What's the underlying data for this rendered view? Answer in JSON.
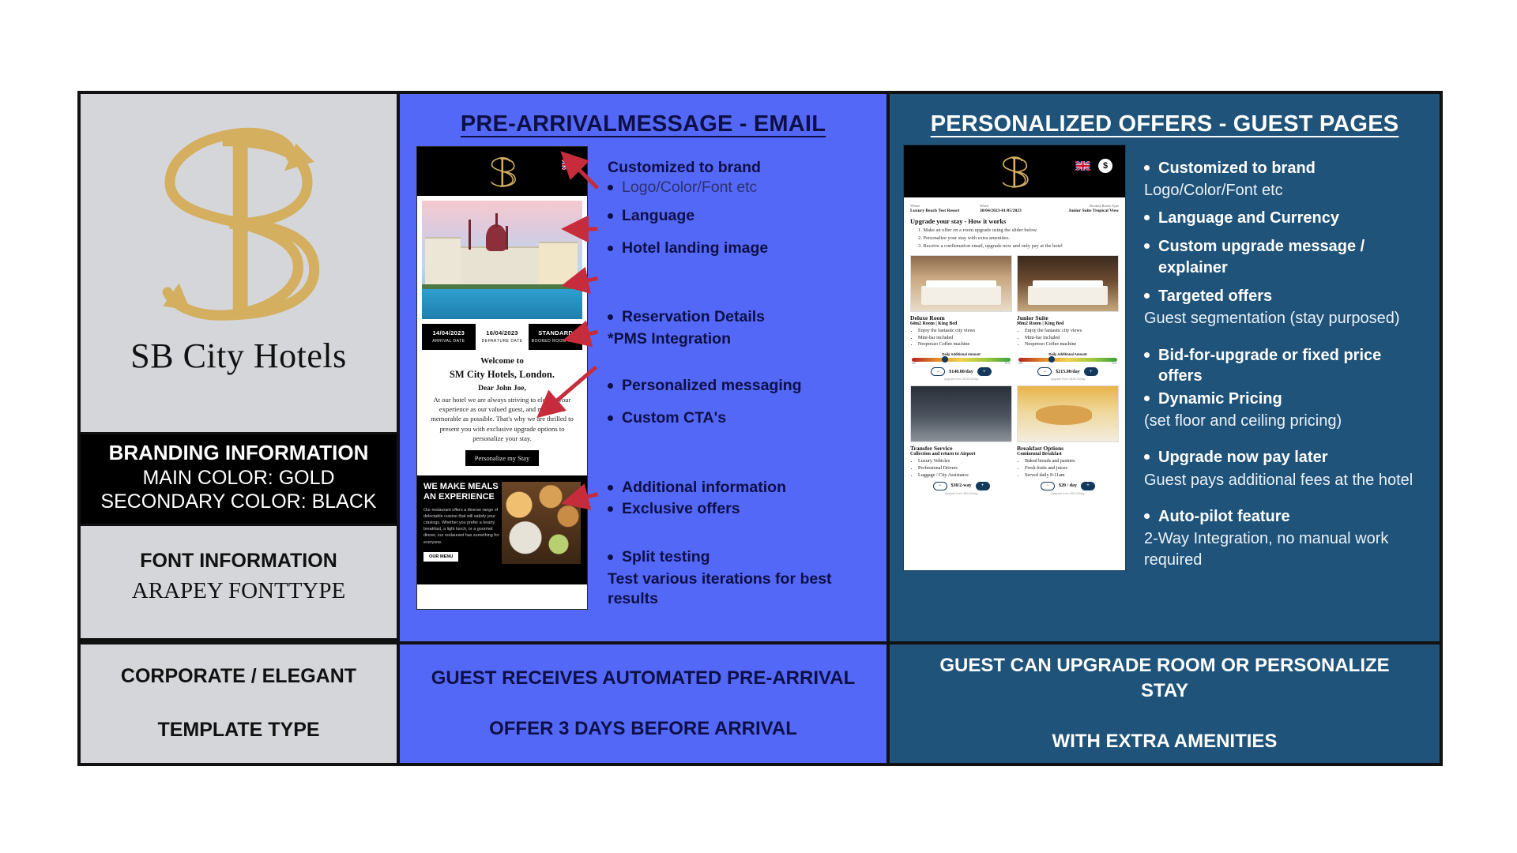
{
  "brand": {
    "logo_icon": "sb-monogram-logo",
    "name": "SB City Hotels",
    "branding_title": "BRANDING INFORMATION",
    "main_color_line": "MAIN COLOR: GOLD",
    "secondary_color_line": "SECONDARY COLOR: BLACK",
    "font_title": "FONT INFORMATION",
    "font_value": "ARAPEY FONTTYPE",
    "template_type": "CORPORATE / ELEGANT\nTEMPLATE TYPE",
    "template_type_line1": "CORPORATE / ELEGANT",
    "template_type_line2": "TEMPLATE TYPE",
    "colors": {
      "gold": "#d4af5f",
      "black": "#000000",
      "panel_bg": "#d4d6d9"
    }
  },
  "email_panel": {
    "title": "PRE-ARRIVALMESSAGE - EMAIL",
    "accent": "#5468f7",
    "text_color": "#0d1046",
    "bullets": [
      {
        "text": "Customized to brand",
        "bold": true,
        "bullet": false
      },
      {
        "text": "Logo/Color/Font etc",
        "bold": false,
        "bullet": true
      },
      {
        "text": "Language",
        "bold": true,
        "bullet": true
      },
      {
        "text": "Hotel landing image",
        "bold": true,
        "bullet": true
      },
      {
        "text": "Reservation Details",
        "bold": true,
        "bullet": true
      },
      {
        "text": "*PMS Integration",
        "bold": true,
        "bullet": false
      },
      {
        "text": "Personalized messaging",
        "bold": true,
        "bullet": true
      },
      {
        "text": "Custom CTA's",
        "bold": true,
        "bullet": true
      },
      {
        "text": "Additional information",
        "bold": true,
        "bullet": true
      },
      {
        "text": "Exclusive offers",
        "bold": true,
        "bullet": true
      },
      {
        "text": "Split testing",
        "bold": true,
        "bullet": true
      },
      {
        "text": "Test various iterations for best results",
        "bold": true,
        "bullet": false
      }
    ],
    "mockup": {
      "flag_icon": "uk-flag-icon",
      "logo_icon": "sb-monogram-logo",
      "hero_icon": "budapest-parliament-photo",
      "dates": [
        {
          "value": "14/04/2023",
          "label": "ARRIVAL DATE"
        },
        {
          "value": "16/04/2023",
          "label": "DEPARTURE DATE"
        },
        {
          "value": "STANDARD",
          "label": "BOOKED ROOM TYPE"
        }
      ],
      "welcome_small": "Welcome to",
      "welcome_hotel": "SM City Hotels, London.",
      "salutation": "Dear John Joe,",
      "body": "At our hotel we are always striving to elevate your experience as our valued guest, and make it as memorable as possible. That's why we are thrilled to present you with exclusive upgrade options to personalize your stay.",
      "cta": "Personalize my Stay",
      "footer_heading": "WE MAKE MEALS AN EXPERIENCE",
      "footer_body": "Our restaurant offers a diverse range of delectable cuisine that will satisfy your cravings. Whether you prefer a hearty breakfast, a light lunch, or a gourmet dinner, our restaurant has something for everyone.",
      "footer_button": "OUR MENU",
      "footer_image_icon": "restaurant-food-photo"
    },
    "bottom_bar_line1": "GUEST RECEIVES AUTOMATED PRE-ARRIVAL",
    "bottom_bar_line2": "OFFER 3 DAYS BEFORE ARRIVAL"
  },
  "offers_panel": {
    "title": "PERSONALIZED OFFERS - GUEST PAGES",
    "accent": "#1f537a",
    "text_color": "#ffffff",
    "bullets": [
      {
        "text": "Customized to brand",
        "bold": true,
        "bullet": true
      },
      {
        "text": "Logo/Color/Font etc",
        "bold": false,
        "bullet": false
      },
      {
        "text": "Language and Currency",
        "bold": true,
        "bullet": true
      },
      {
        "text": "Custom upgrade message / explainer",
        "bold": true,
        "bullet": true
      },
      {
        "text": "Targeted offers",
        "bold": true,
        "bullet": true
      },
      {
        "text": "Guest segmentation (stay purposed)",
        "bold": false,
        "bullet": false
      },
      {
        "text": "Bid-for-upgrade or fixed price offers",
        "bold": true,
        "bullet": true
      },
      {
        "text": "Dynamic Pricing",
        "bold": true,
        "bullet": true
      },
      {
        "text": "(set floor and ceiling pricing)",
        "bold": false,
        "bullet": false
      },
      {
        "text": "Upgrade now pay later",
        "bold": true,
        "bullet": true
      },
      {
        "text": "Guest pays additional fees at the hotel",
        "bold": false,
        "bullet": false
      },
      {
        "text": "Auto-pilot feature",
        "bold": true,
        "bullet": true
      },
      {
        "text": "2-Way Integration, no manual work required",
        "bold": false,
        "bullet": false
      }
    ],
    "mockup": {
      "flag_icon": "uk-flag-icon",
      "currency_icon": "dollar-coin-icon",
      "logo_icon": "sb-monogram-logo",
      "meta": [
        {
          "label": "Where",
          "value": "Luxury Beach Test Resort"
        },
        {
          "label": "When",
          "value": "30/04/2023-01/05/2023"
        },
        {
          "label": "Booked Room Type",
          "value": "Junior Suite Tropical View"
        }
      ],
      "how_it_works_title": "Upgrade your stay - How it works",
      "steps": [
        "1. Make an offer on a room upgrade using the slider below.",
        "2. Personalize your stay with extra amenities.",
        "3. Receive a confirmation email, upgrade now and only pay at the hotel"
      ],
      "cards": [
        {
          "title": "Deluxe Room",
          "subtitle": "64m2 Room | King Bed",
          "features": [
            "Enjoy the fantastic city views",
            "Mini-bar included",
            "Nespresso Coffee machine"
          ],
          "amount_label": "Daily Additional Amount",
          "price": "$140.00/day",
          "note": "Upgrade from: $100.00/day",
          "image_icon": "deluxe-room-photo",
          "slider_min": "$60",
          "slider_max": "$260"
        },
        {
          "title": "Junior Suite",
          "subtitle": "98m2 Room | King Bed",
          "features": [
            "Enjoy the fantastic city views",
            "Mini-bar included",
            "Nespresso Coffee machine"
          ],
          "amount_label": "Daily Additional Amount",
          "price": "$215.00/day",
          "note": "Upgrade from: $180.00/day",
          "image_icon": "junior-suite-photo",
          "slider_min": "$80",
          "slider_max": "$360"
        },
        {
          "title": "Transfer Service",
          "subtitle": "Collection and return to Airport",
          "features": [
            "Luxury Vehicles",
            "Professional Drivers",
            "Luggage / City Assistance"
          ],
          "amount_label": "",
          "price": "$30/2-way",
          "note": "Upgrade from: $60.00/day",
          "image_icon": "airport-transfer-photo",
          "slider_min": "",
          "slider_max": ""
        },
        {
          "title": "Breakfast Options",
          "subtitle": "Continental Breakfast",
          "features": [
            "Baked breads and pastries",
            "Fresh fruits and juices",
            "Served daily 8-11am"
          ],
          "amount_label": "",
          "price": "$20 / day",
          "note": "Upgrade from: $30.00/day",
          "image_icon": "breakfast-photo",
          "slider_min": "",
          "slider_max": ""
        }
      ]
    },
    "bottom_bar_line1": "GUEST CAN UPGRADE ROOM OR PERSONALIZE STAY",
    "bottom_bar_line2": "WITH EXTRA AMENITIES"
  }
}
